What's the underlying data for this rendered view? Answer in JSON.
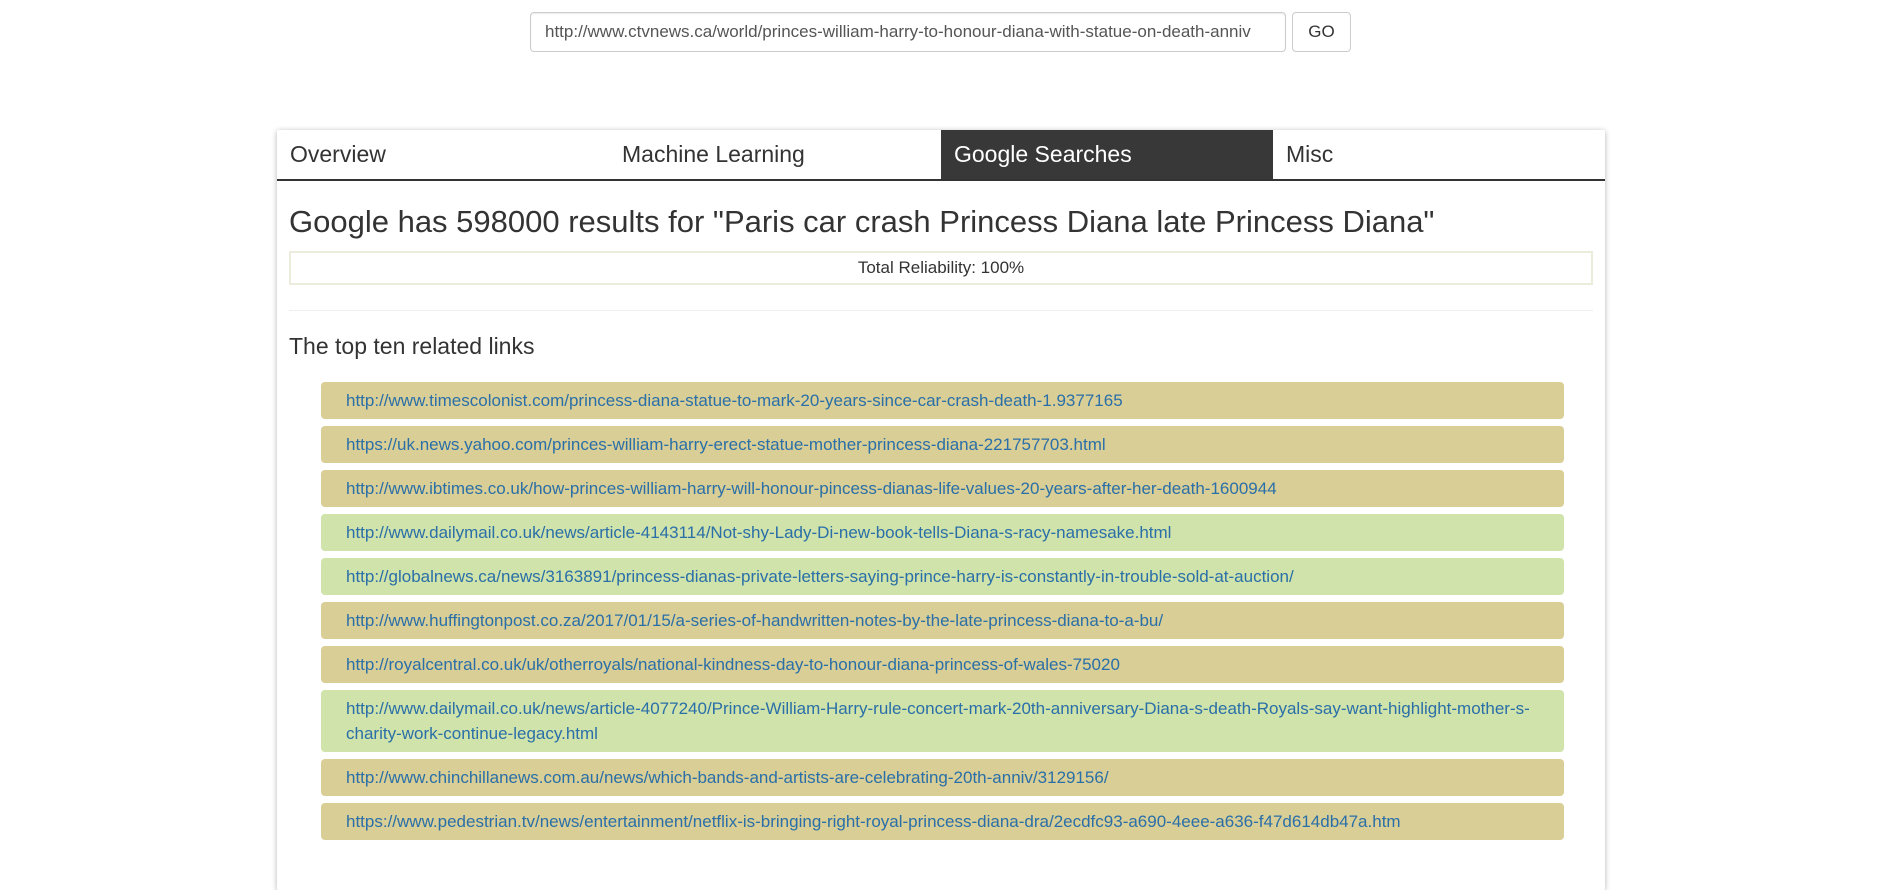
{
  "search": {
    "url_value": "http://www.ctvnews.ca/world/princes-william-harry-to-honour-diana-with-statue-on-death-anniv",
    "go_label": "GO"
  },
  "tabs": [
    {
      "label": "Overview",
      "active": false
    },
    {
      "label": "Machine Learning",
      "active": false
    },
    {
      "label": "Google Searches",
      "active": true
    },
    {
      "label": "Misc",
      "active": false
    }
  ],
  "main": {
    "heading": "Google has 598000 results for \"Paris car crash Princess Diana late Princess Diana\"",
    "reliability": "Total Reliability: 100%",
    "subheading": "The top ten related links"
  },
  "colors": {
    "tan": "#d9ce95",
    "green": "#cfe3aa",
    "active_tab": "#383838",
    "link": "#2a6fa8"
  },
  "links": [
    {
      "url": "http://www.timescolonist.com/princess-diana-statue-to-mark-20-years-since-car-crash-death-1.9377165",
      "color": "tan"
    },
    {
      "url": "https://uk.news.yahoo.com/princes-william-harry-erect-statue-mother-princess-diana-221757703.html",
      "color": "tan"
    },
    {
      "url": "http://www.ibtimes.co.uk/how-princes-william-harry-will-honour-pincess-dianas-life-values-20-years-after-her-death-1600944",
      "color": "tan"
    },
    {
      "url": "http://www.dailymail.co.uk/news/article-4143114/Not-shy-Lady-Di-new-book-tells-Diana-s-racy-namesake.html",
      "color": "green"
    },
    {
      "url": "http://globalnews.ca/news/3163891/princess-dianas-private-letters-saying-prince-harry-is-constantly-in-trouble-sold-at-auction/",
      "color": "green"
    },
    {
      "url": "http://www.huffingtonpost.co.za/2017/01/15/a-series-of-handwritten-notes-by-the-late-princess-diana-to-a-bu/",
      "color": "tan"
    },
    {
      "url": "http://royalcentral.co.uk/uk/otherroyals/national-kindness-day-to-honour-diana-princess-of-wales-75020",
      "color": "tan"
    },
    {
      "url": "http://www.dailymail.co.uk/news/article-4077240/Prince-William-Harry-rule-concert-mark-20th-anniversary-Diana-s-death-Royals-say-want-highlight-mother-s-charity-work-continue-legacy.html",
      "color": "green"
    },
    {
      "url": "http://www.chinchillanews.com.au/news/which-bands-and-artists-are-celebrating-20th-anniv/3129156/",
      "color": "tan"
    },
    {
      "url": "https://www.pedestrian.tv/news/entertainment/netflix-is-bringing-right-royal-princess-diana-dra/2ecdfc93-a690-4eee-a636-f47d614db47a.htm",
      "color": "tan"
    }
  ]
}
